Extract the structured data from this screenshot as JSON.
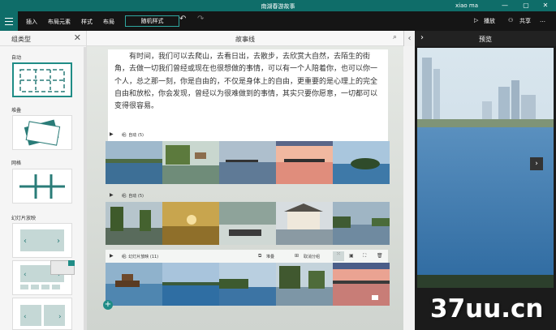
{
  "window": {
    "title": "南湖春游故事",
    "user": "xiao ma",
    "controls": [
      "—",
      "▢",
      "✕"
    ]
  },
  "ribbon": {
    "menu": [
      "插入",
      "布局元素",
      "样式",
      "布局"
    ],
    "random_style": "随机样式",
    "undo_icon": "undo-icon",
    "redo_icon": "redo-icon",
    "play": "播放",
    "share": "共享"
  },
  "left_panel": {
    "title": "组类型",
    "groups": [
      {
        "label": "自动"
      },
      {
        "label": "堆叠"
      },
      {
        "label": "网格"
      },
      {
        "label": "幻灯片放映"
      }
    ]
  },
  "storyline": {
    "title": "故事线",
    "text": "有时间，我们可以去爬山，去看日出，去散步，去欣赏大自然，去陌生的街角，去做一切我们曾经或现在也很想做的事情，可以有一个人陪着你，也可以你一个人，总之那一刻，你是自由的，不仅是身体上的自由，更重要的是心理上的完全自由和放松，你会发现，曾经以为很难做到的事情，其实只要你愿意，一切都可以变得很容易。",
    "groups": [
      {
        "label": "组: 自动 (5)"
      },
      {
        "label": "组: 自动 (5)"
      },
      {
        "label": "组: 幻灯片放映 (11)",
        "tools": [
          "堆叠",
          "取消分组"
        ]
      }
    ]
  },
  "preview": {
    "title": "预览"
  },
  "watermark": "37uu.cn",
  "colors": {
    "accent": "#0f6d69",
    "ribbon": "#151515"
  }
}
